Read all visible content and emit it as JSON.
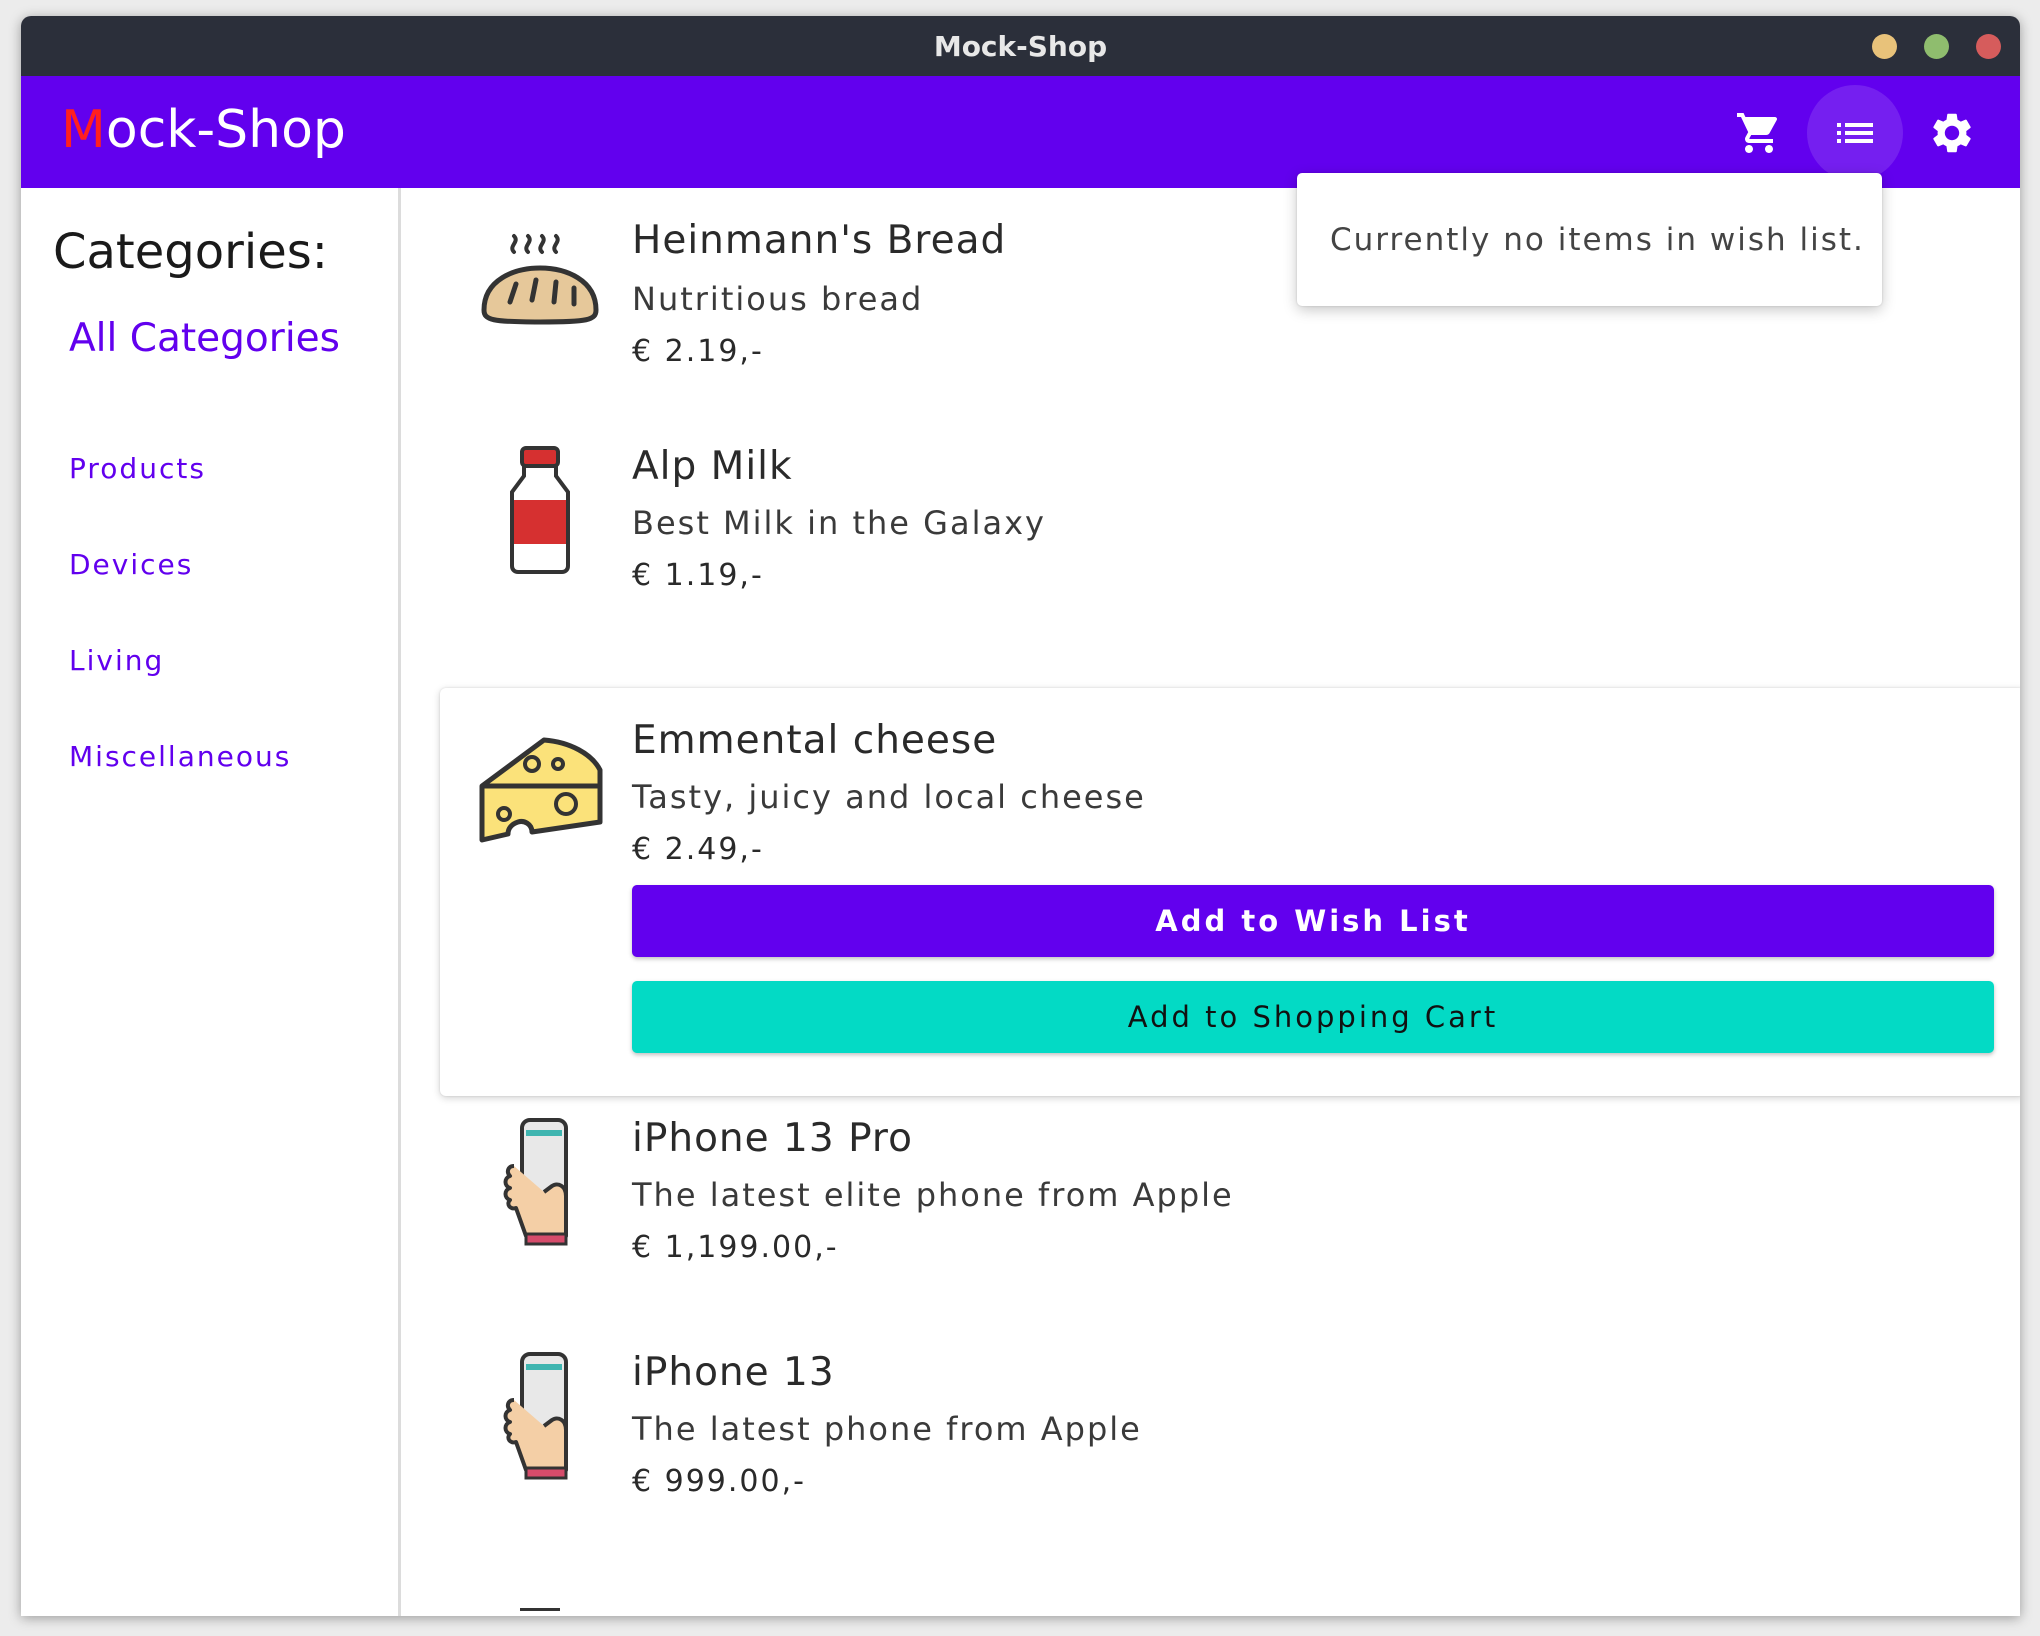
{
  "window": {
    "title": "Mock-Shop"
  },
  "appbar": {
    "brand_initial": "M",
    "brand_rest": "ock-Shop",
    "icons": [
      "cart-icon",
      "wish-list-icon",
      "settings-icon"
    ]
  },
  "sidebar": {
    "title": "Categories:",
    "all": "All Categories",
    "categories": [
      "Products",
      "Devices",
      "Living",
      "Miscellaneous"
    ]
  },
  "wishlist_popover": {
    "text": "Currently no items in wish list."
  },
  "products": [
    {
      "name": "Heinmann's Bread",
      "desc": "Nutritious bread",
      "price": "€ 2.19,-",
      "icon": "bread-icon"
    },
    {
      "name": "Alp Milk",
      "desc": "Best Milk in the Galaxy",
      "price": "€ 1.19,-",
      "icon": "milk-bottle-icon"
    },
    {
      "name": "Emmental cheese",
      "desc": "Tasty, juicy and local cheese",
      "price": "€ 2.49,-",
      "icon": "cheese-icon",
      "add_wish_label": "Add to Wish List",
      "add_cart_label": "Add to Shopping Cart"
    },
    {
      "name": "iPhone 13 Pro",
      "desc": "The latest elite phone from Apple",
      "price": "€ 1,199.00,-",
      "icon": "phone-in-hand-icon"
    },
    {
      "name": "iPhone 13",
      "desc": "The latest phone from Apple",
      "price": "€ 999.00,-",
      "icon": "phone-in-hand-icon"
    }
  ],
  "colors": {
    "primary": "#6200ee",
    "secondary": "#03dac5",
    "brand_initial": "#ff1f1f"
  }
}
